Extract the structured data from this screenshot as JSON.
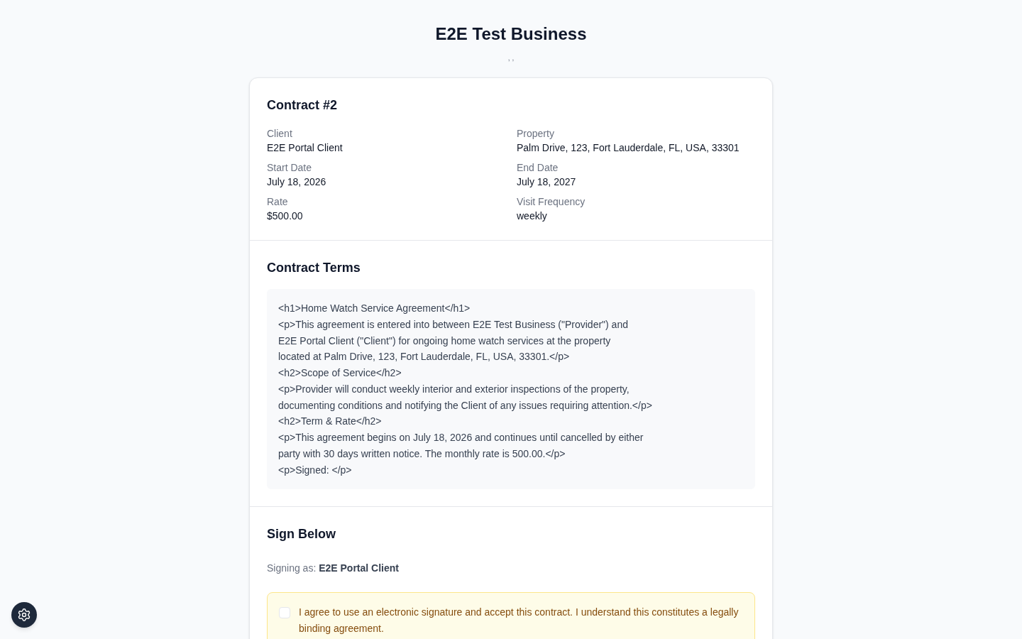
{
  "header": {
    "business_name": "E2E Test Business",
    "address": ", ,"
  },
  "contract": {
    "title": "Contract #2",
    "fields": [
      {
        "label": "Client",
        "value": "E2E Portal Client"
      },
      {
        "label": "Property",
        "value": "Palm Drive, 123, Fort Lauderdale, FL, USA, 33301"
      },
      {
        "label": "Start Date",
        "value": "July 18, 2026"
      },
      {
        "label": "End Date",
        "value": "July 18, 2027"
      },
      {
        "label": "Rate",
        "value": "$500.00"
      },
      {
        "label": "Visit Frequency",
        "value": "weekly"
      }
    ]
  },
  "terms": {
    "heading": "Contract Terms",
    "text": "<h1>Home Watch Service Agreement</h1>\n<p>This agreement is entered into between E2E Test Business (\"Provider\") and\nE2E Portal Client (\"Client\") for ongoing home watch services at the property\nlocated at Palm Drive, 123, Fort Lauderdale, FL, USA, 33301.</p>\n<h2>Scope of Service</h2>\n<p>Provider will conduct weekly interior and exterior inspections of the property,\ndocumenting conditions and notifying the Client of any issues requiring attention.</p>\n<h2>Term & Rate</h2>\n<p>This agreement begins on July 18, 2026 and continues until cancelled by either\nparty with 30 days written notice. The monthly rate is 500.00.</p>\n<p>Signed: </p>"
  },
  "sign": {
    "heading": "Sign Below",
    "signing_as": "Signing as: **E2E Portal Client**",
    "agreement": {
      "checked": false,
      "text": "I agree to use an electronic signature and accept this contract. I understand this constitutes a legally binding agreement."
    }
  }
}
